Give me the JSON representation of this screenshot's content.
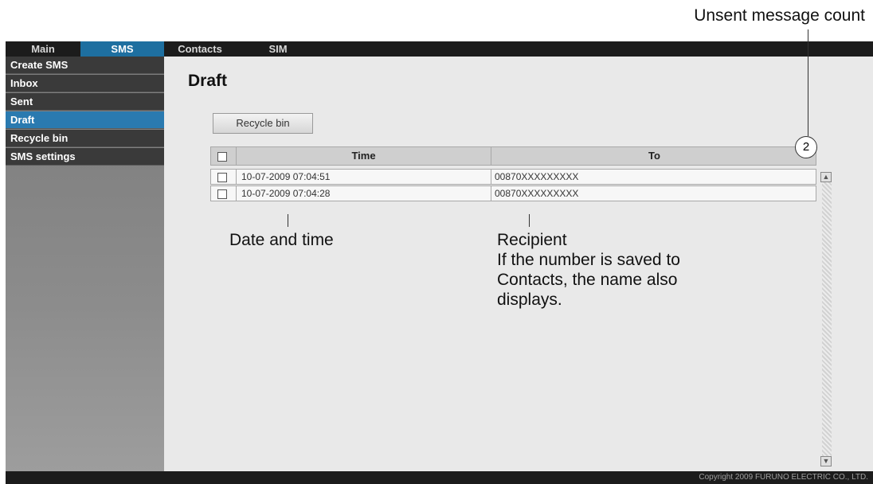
{
  "nav": {
    "tabs": [
      {
        "label": "Main"
      },
      {
        "label": "SMS"
      },
      {
        "label": "Contacts"
      },
      {
        "label": "SIM"
      }
    ]
  },
  "sidebar": {
    "items": [
      {
        "label": "Create SMS"
      },
      {
        "label": "Inbox"
      },
      {
        "label": "Sent"
      },
      {
        "label": "Draft"
      },
      {
        "label": "Recycle bin"
      },
      {
        "label": "SMS settings"
      }
    ]
  },
  "main": {
    "title": "Draft",
    "recycle_button": "Recycle bin",
    "table": {
      "columns": [
        "Time",
        "To"
      ],
      "rows": [
        {
          "time": "10-07-2009 07:04:51",
          "to": "00870XXXXXXXXX"
        },
        {
          "time": "10-07-2009 07:04:28",
          "to": "00870XXXXXXXXX"
        }
      ]
    }
  },
  "footer": {
    "copyright": "Copyright 2009 FURUNO ELECTRIC CO., LTD."
  },
  "annotations": {
    "unsent_count_label": "Unsent message count",
    "unsent_count_value": "2",
    "date_time_label": "Date and time",
    "recipient_label": "Recipient",
    "recipient_note_1": "If the number is saved to",
    "recipient_note_2": "Contacts, the name also",
    "recipient_note_3": "displays."
  }
}
